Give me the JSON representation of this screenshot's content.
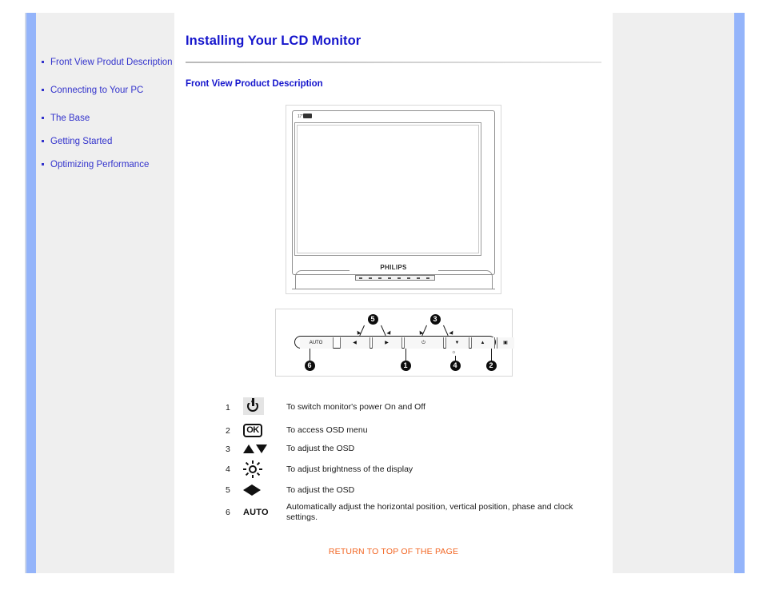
{
  "sidebar": {
    "items": [
      {
        "label": "Front View Produt Description",
        "name": "sidebar-item-front-view"
      },
      {
        "label": "Connecting to Your PC",
        "name": "sidebar-item-connecting-pc"
      },
      {
        "label": "The Base",
        "name": "sidebar-item-the-base"
      },
      {
        "label": "Getting Started",
        "name": "sidebar-item-getting-started"
      },
      {
        "label": "Optimizing Performance",
        "name": "sidebar-item-optimizing-performance"
      }
    ]
  },
  "main": {
    "page_title": "Installing Your LCD Monitor",
    "section_heading": "Front View Product Description"
  },
  "monitor_figure": {
    "brand": "PHILIPS",
    "corner_mark": "17\"",
    "alt": "front view of LCD monitor"
  },
  "control_panel": {
    "alt": "front control panel with six buttons",
    "buttons": [
      {
        "label": "AUTO",
        "glyph": "AUTO",
        "callout": "6"
      },
      {
        "label": "left",
        "glyph": "◀",
        "callout": "5"
      },
      {
        "label": "right",
        "glyph": "▶",
        "callout": "5"
      },
      {
        "label": "power",
        "glyph": "⏻",
        "callout": "1"
      },
      {
        "label": "down",
        "glyph": "▼",
        "callout": "3"
      },
      {
        "label": "up",
        "glyph": "▲",
        "callout": "3"
      },
      {
        "label": "ok",
        "glyph": "▣",
        "callout": "2"
      }
    ],
    "brightness_callout": "4",
    "badges": [
      "1",
      "2",
      "3",
      "4",
      "5",
      "6"
    ]
  },
  "legend": {
    "rows": [
      {
        "num": "1",
        "icon": "power-icon",
        "description": "To switch monitor's power On and Off"
      },
      {
        "num": "2",
        "icon": "ok-icon",
        "description": "To access OSD menu"
      },
      {
        "num": "3",
        "icon": "up-down-arrows-icon",
        "description": "To adjust the OSD"
      },
      {
        "num": "4",
        "icon": "brightness-icon",
        "description": "To adjust brightness of the display"
      },
      {
        "num": "5",
        "icon": "left-right-arrows-icon",
        "description": "To adjust the OSD"
      },
      {
        "num": "6",
        "icon": "auto-icon",
        "description": "Automatically adjust the horizontal position, vertical position, phase and clock settings."
      }
    ],
    "auto_label": "AUTO",
    "ok_label": "OK"
  },
  "footer": {
    "return_top": "RETURN TO TOP OF THE PAGE"
  },
  "colors": {
    "accent_blue": "#3333cc",
    "title_blue": "#1515cc",
    "rail_blue": "#94b4fa",
    "sidebar_gray": "#efefef",
    "link_orange": "#f26522"
  }
}
